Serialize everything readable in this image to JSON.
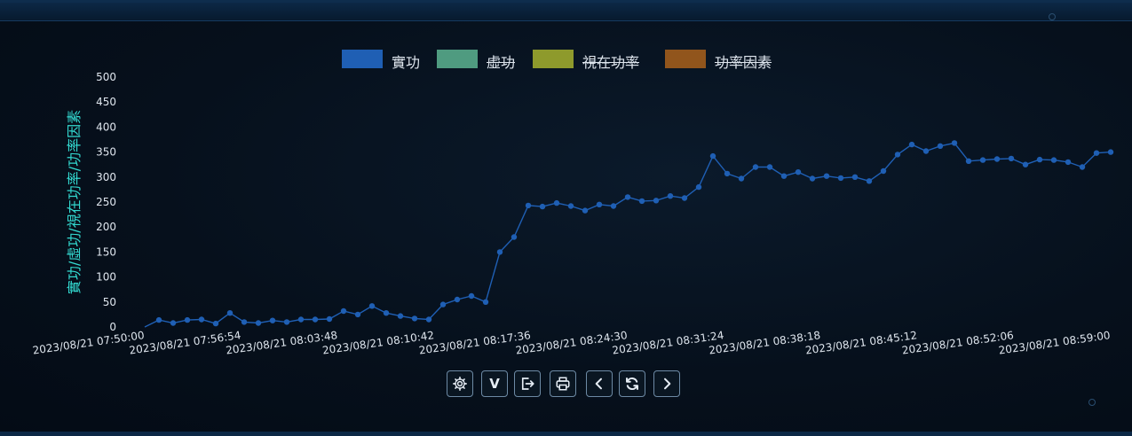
{
  "colors": {
    "series_active": "#1f5fb4",
    "axis_label": "#33d9d0",
    "tick_text": "#dfe6ee"
  },
  "legend": [
    {
      "label": "實功",
      "color": "#1f5fb4",
      "active": true
    },
    {
      "label": "虛功",
      "color": "#4f9b80",
      "active": false
    },
    {
      "label": "視在功率",
      "color": "#8e9a2c",
      "active": false
    },
    {
      "label": "功率因素",
      "color": "#91551c",
      "active": false
    }
  ],
  "chart_data": {
    "type": "line",
    "ylabel": "實功/虛功/視在功率/功率因素",
    "xlabel": "",
    "ylim": [
      0,
      500
    ],
    "yticks": [
      0,
      50,
      100,
      150,
      200,
      250,
      300,
      350,
      400,
      450,
      500
    ],
    "grid": false,
    "legend_position": "top-center",
    "xticks": [
      "2023/08/21 07:50:00",
      "2023/08/21 07:56:54",
      "2023/08/21 08:03:48",
      "2023/08/21 08:10:42",
      "2023/08/21 08:17:36",
      "2023/08/21 08:24:30",
      "2023/08/21 08:31:24",
      "2023/08/21 08:38:18",
      "2023/08/21 08:45:12",
      "2023/08/21 08:52:06",
      "2023/08/21 08:59:00"
    ],
    "x_start": "2023/08/21 07:50:00",
    "x_end": "2023/08/21 08:59:00",
    "series": [
      {
        "name": "實功",
        "values": [
          0,
          14,
          8,
          14,
          15,
          7,
          28,
          10,
          8,
          13,
          10,
          15,
          15,
          16,
          32,
          25,
          42,
          28,
          22,
          17,
          15,
          45,
          55,
          62,
          50,
          150,
          180,
          243,
          241,
          248,
          242,
          233,
          245,
          242,
          260,
          252,
          253,
          262,
          258,
          280,
          342,
          307,
          297,
          320,
          320,
          302,
          310,
          297,
          302,
          298,
          300,
          292,
          312,
          345,
          365,
          352,
          362,
          368,
          332,
          334,
          336,
          337,
          325,
          335,
          334,
          330,
          320,
          348,
          350
        ]
      }
    ]
  },
  "toolbar": {
    "buttons": [
      {
        "name": "settings",
        "icon": "gear-icon"
      },
      {
        "name": "view-v",
        "label": "V"
      },
      {
        "name": "export",
        "icon": "export-icon"
      },
      {
        "name": "print",
        "icon": "printer-icon"
      },
      {
        "name": "previous",
        "icon": "chevron-left-icon"
      },
      {
        "name": "refresh",
        "icon": "refresh-icon"
      },
      {
        "name": "next",
        "icon": "chevron-right-icon"
      }
    ]
  }
}
